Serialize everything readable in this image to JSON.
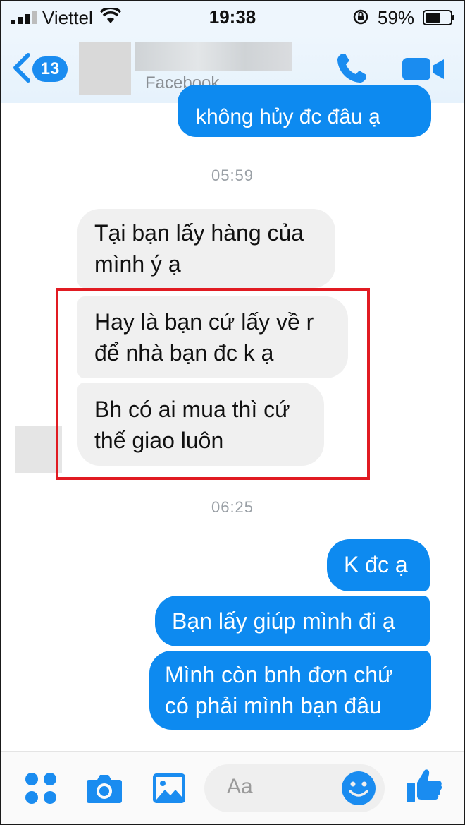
{
  "status": {
    "carrier": "Viettel",
    "time": "19:38",
    "battery": "59%"
  },
  "header": {
    "unread_count": "13",
    "subtitle": "Facebook"
  },
  "chat": {
    "top_cut_message": "không hủy đc đâu ạ",
    "timestamp_1": "05:59",
    "incoming": [
      "Tại bạn lấy hàng của\nmình ý ạ",
      "Hay là bạn cứ lấy về r\nđể nhà bạn đc k ạ",
      "Bh có ai mua thì cứ\nthế giao luôn"
    ],
    "timestamp_2": "06:25",
    "outgoing": [
      "K đc ạ",
      "Bạn lấy giúp mình đi ạ",
      "Mình còn bnh đơn chứ\ncó phải mình bạn đâu"
    ]
  },
  "composer": {
    "placeholder": "Aa"
  },
  "colors": {
    "accent": "#0d8af0",
    "highlight": "#e11b22"
  },
  "icons": [
    "back-chevron-icon",
    "phone-icon",
    "video-camera-icon",
    "apps-icon",
    "camera-icon",
    "image-icon",
    "emoji-icon",
    "thumbs-up-icon"
  ]
}
